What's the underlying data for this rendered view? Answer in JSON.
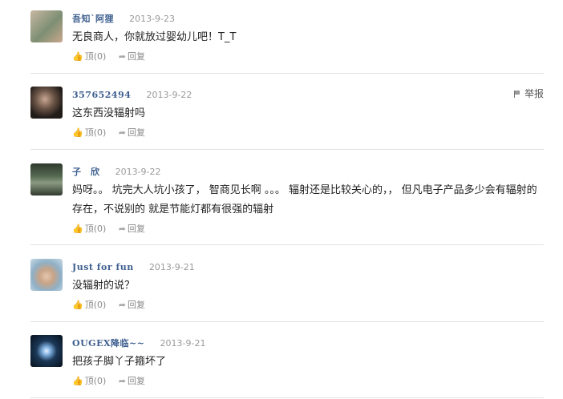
{
  "ui": {
    "like_label": "顶",
    "reply_label": "回复",
    "report_label": "举报"
  },
  "comments": [
    {
      "user": "吾知`阿狸",
      "time": "2013-9-23",
      "text": "无良商人，你就放过婴幼儿吧！T_T",
      "likes": "(0)",
      "avatar_color": "#8a9a7c"
    },
    {
      "user": "357652494",
      "time": "2013-9-22",
      "text": "这东西没辐射吗",
      "likes": "(0)",
      "avatar_color": "#4a4038"
    },
    {
      "user": "子　欣",
      "time": "2013-9-22",
      "text": "妈呀。。 坑完大人坑小孩了， 智商见长啊 。。。 辐射还是比较关心的，， 但凡电子产品多少会有辐射的存在，不说别的 就是节能灯都有很强的辐射",
      "likes": "(0)",
      "avatar_color": "#5d6d55"
    },
    {
      "user": "Just for fun",
      "time": "2013-9-21",
      "text": "没辐射的说？",
      "likes": "(0)",
      "avatar_color": "#a0b8c8"
    },
    {
      "user": "OUGEX降临~~",
      "time": "2013-9-21",
      "text": "把孩子脚丫子箍坏了",
      "likes": "(0)",
      "avatar_color": "#0e1a28"
    }
  ]
}
